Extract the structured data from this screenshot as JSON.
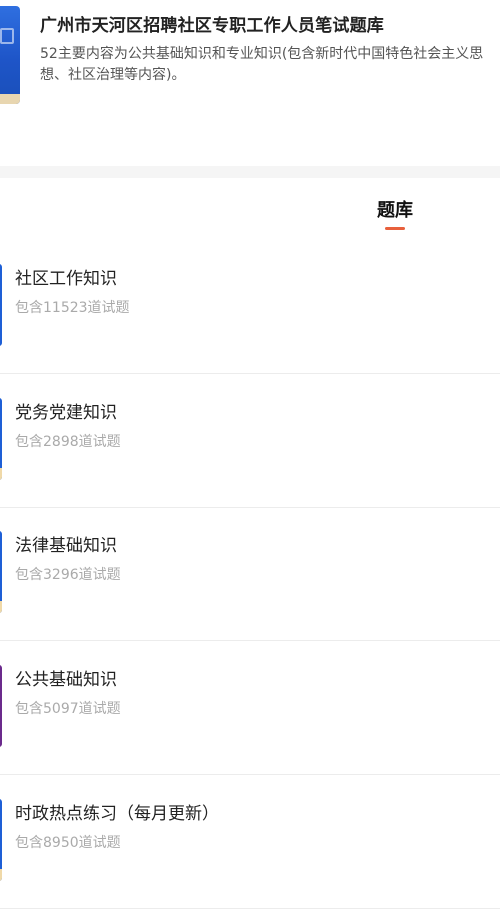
{
  "bank": {
    "title": "广州市天河区招聘社区专职工作人员笔试题库",
    "description": "52主要内容为公共基础知识和专业知识(包含新时代中国特色社会主义思想、社区治理等内容)。",
    "cover_color": "#2f6fe0"
  },
  "tab": {
    "label": "题库",
    "indicator_color": "#e8603c"
  },
  "categories": [
    {
      "name": "社区工作知识",
      "count_text": "包含11523道试题",
      "color": "#1e5fd6"
    },
    {
      "name": "党务党建知识",
      "count_text": "包含2898道试题",
      "color": "#1e5fd6"
    },
    {
      "name": "法律基础知识",
      "count_text": "包含3296道试题",
      "color": "#1e5fd6"
    },
    {
      "name": "公共基础知识",
      "count_text": "包含5097道试题",
      "color": "#6b2a8c"
    },
    {
      "name": "时政热点练习（每月更新）",
      "count_text": "包含8950道试题",
      "color": "#1e5fd6"
    }
  ]
}
